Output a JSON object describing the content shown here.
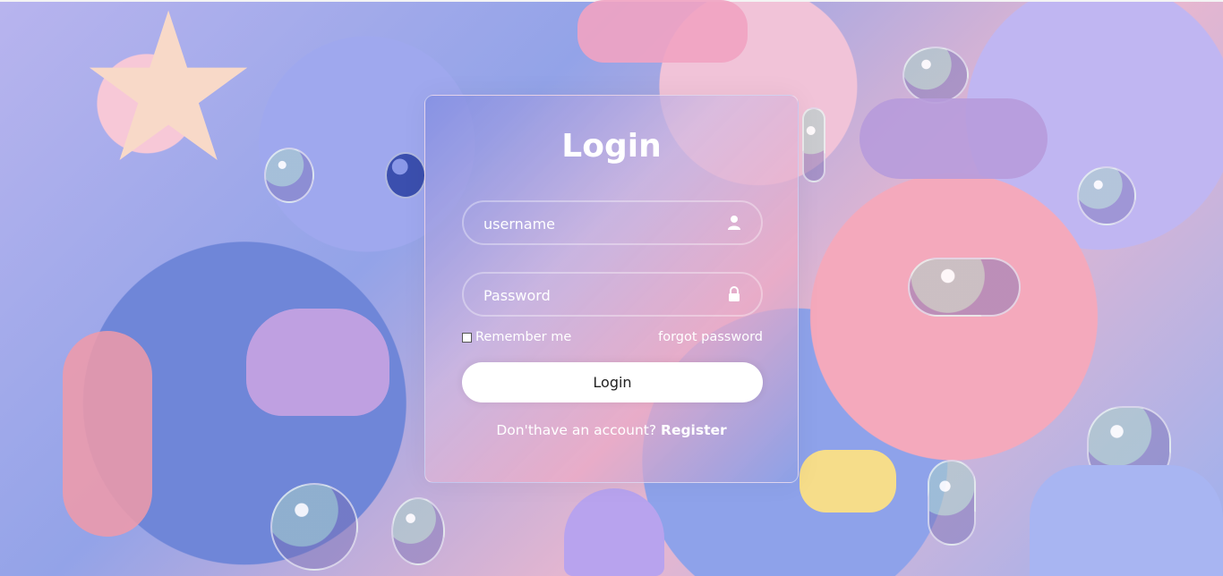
{
  "login": {
    "title": "Login",
    "username_placeholder": "username",
    "password_placeholder": "Password",
    "remember_label": "Remember me",
    "forgot_label": "forgot password",
    "button_label": "Login",
    "register_prompt": "Don'thave an account?",
    "register_link": "Register"
  },
  "icons": {
    "username": "user-icon",
    "password": "lock-icon"
  },
  "colors": {
    "accent": "#ffffff",
    "button_text": "#222222"
  }
}
